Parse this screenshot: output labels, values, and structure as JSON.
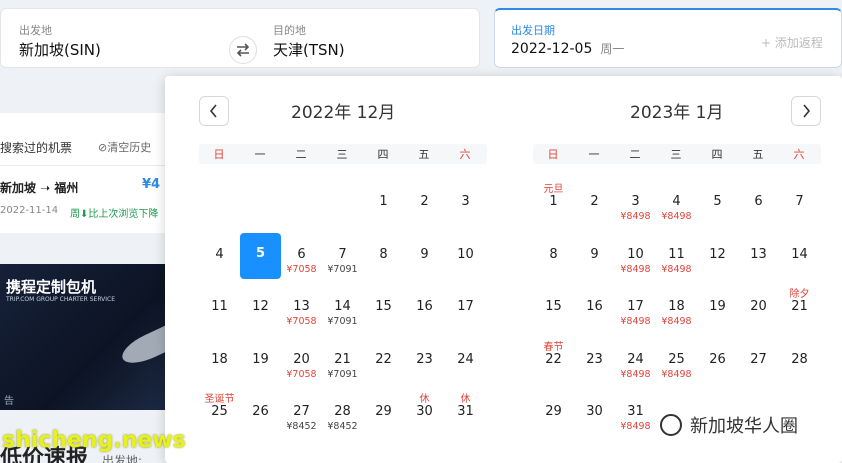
{
  "search": {
    "from_label": "出发地",
    "from_value": "新加坡(SIN)",
    "to_label": "目的地",
    "to_value": "天津(TSN)",
    "date_label": "出发日期",
    "date_value": "2022-12-05",
    "date_week": "周一",
    "return_label": "+ 添加返程"
  },
  "history": {
    "title": "搜索过的机票",
    "clear": "⊘清空历史",
    "route": "新加坡 ➝ 福州",
    "price": "¥4",
    "date": "2022-11-14",
    "trend": "周⬇比上次浏览下降"
  },
  "banner": {
    "title": "携程定制包机",
    "subtitle": "TRIP.COM GROUP CHARTER SERVICE",
    "tag": "告"
  },
  "bottom": {
    "text": "低价速报",
    "sub": "出发地:"
  },
  "calendar": {
    "weekdays": [
      "日",
      "一",
      "二",
      "三",
      "四",
      "五",
      "六"
    ],
    "months": [
      {
        "title": "2022年 12月",
        "days": [
          {
            "n": "1",
            "col": 4,
            "row": 0
          },
          {
            "n": "2",
            "col": 5,
            "row": 0
          },
          {
            "n": "3",
            "col": 6,
            "row": 0
          },
          {
            "n": "4",
            "col": 0,
            "row": 1
          },
          {
            "n": "5",
            "col": 1,
            "row": 1,
            "selected": true
          },
          {
            "n": "6",
            "col": 2,
            "row": 1,
            "price": "¥7058",
            "red": true
          },
          {
            "n": "7",
            "col": 3,
            "row": 1,
            "price": "¥7091"
          },
          {
            "n": "8",
            "col": 4,
            "row": 1
          },
          {
            "n": "9",
            "col": 5,
            "row": 1
          },
          {
            "n": "10",
            "col": 6,
            "row": 1
          },
          {
            "n": "11",
            "col": 0,
            "row": 2
          },
          {
            "n": "12",
            "col": 1,
            "row": 2
          },
          {
            "n": "13",
            "col": 2,
            "row": 2,
            "price": "¥7058",
            "red": true
          },
          {
            "n": "14",
            "col": 3,
            "row": 2,
            "price": "¥7091"
          },
          {
            "n": "15",
            "col": 4,
            "row": 2
          },
          {
            "n": "16",
            "col": 5,
            "row": 2
          },
          {
            "n": "17",
            "col": 6,
            "row": 2
          },
          {
            "n": "18",
            "col": 0,
            "row": 3
          },
          {
            "n": "19",
            "col": 1,
            "row": 3
          },
          {
            "n": "20",
            "col": 2,
            "row": 3,
            "price": "¥7058",
            "red": true
          },
          {
            "n": "21",
            "col": 3,
            "row": 3,
            "price": "¥7091"
          },
          {
            "n": "22",
            "col": 4,
            "row": 3
          },
          {
            "n": "23",
            "col": 5,
            "row": 3
          },
          {
            "n": "24",
            "col": 6,
            "row": 3
          },
          {
            "n": "25",
            "col": 0,
            "row": 4,
            "fest": "圣诞节"
          },
          {
            "n": "26",
            "col": 1,
            "row": 4
          },
          {
            "n": "27",
            "col": 2,
            "row": 4,
            "price": "¥8452"
          },
          {
            "n": "28",
            "col": 3,
            "row": 4,
            "price": "¥8452"
          },
          {
            "n": "29",
            "col": 4,
            "row": 4
          },
          {
            "n": "30",
            "col": 5,
            "row": 4,
            "fest": "休"
          },
          {
            "n": "31",
            "col": 6,
            "row": 4,
            "fest": "休"
          }
        ]
      },
      {
        "title": "2023年 1月",
        "days": [
          {
            "n": "1",
            "col": 0,
            "row": 0,
            "fest": "元旦"
          },
          {
            "n": "2",
            "col": 1,
            "row": 0
          },
          {
            "n": "3",
            "col": 2,
            "row": 0,
            "price": "¥8498",
            "red": true
          },
          {
            "n": "4",
            "col": 3,
            "row": 0,
            "price": "¥8498",
            "red": true
          },
          {
            "n": "5",
            "col": 4,
            "row": 0
          },
          {
            "n": "6",
            "col": 5,
            "row": 0
          },
          {
            "n": "7",
            "col": 6,
            "row": 0
          },
          {
            "n": "8",
            "col": 0,
            "row": 1
          },
          {
            "n": "9",
            "col": 1,
            "row": 1
          },
          {
            "n": "10",
            "col": 2,
            "row": 1,
            "price": "¥8498",
            "red": true
          },
          {
            "n": "11",
            "col": 3,
            "row": 1,
            "price": "¥8498",
            "red": true
          },
          {
            "n": "12",
            "col": 4,
            "row": 1
          },
          {
            "n": "13",
            "col": 5,
            "row": 1
          },
          {
            "n": "14",
            "col": 6,
            "row": 1
          },
          {
            "n": "15",
            "col": 0,
            "row": 2
          },
          {
            "n": "16",
            "col": 1,
            "row": 2
          },
          {
            "n": "17",
            "col": 2,
            "row": 2,
            "price": "¥8498",
            "red": true
          },
          {
            "n": "18",
            "col": 3,
            "row": 2,
            "price": "¥8498",
            "red": true
          },
          {
            "n": "19",
            "col": 4,
            "row": 2
          },
          {
            "n": "20",
            "col": 5,
            "row": 2
          },
          {
            "n": "21",
            "col": 6,
            "row": 2,
            "fest": "除夕"
          },
          {
            "n": "22",
            "col": 0,
            "row": 3,
            "fest": "春节"
          },
          {
            "n": "23",
            "col": 1,
            "row": 3
          },
          {
            "n": "24",
            "col": 2,
            "row": 3,
            "price": "¥8498",
            "red": true
          },
          {
            "n": "25",
            "col": 3,
            "row": 3,
            "price": "¥8498",
            "red": true
          },
          {
            "n": "26",
            "col": 4,
            "row": 3
          },
          {
            "n": "27",
            "col": 5,
            "row": 3
          },
          {
            "n": "28",
            "col": 6,
            "row": 3
          },
          {
            "n": "29",
            "col": 0,
            "row": 4
          },
          {
            "n": "30",
            "col": 1,
            "row": 4
          },
          {
            "n": "31",
            "col": 2,
            "row": 4,
            "price": "¥8498",
            "red": true
          }
        ]
      }
    ]
  },
  "watermark": {
    "right": "新加坡华人圈",
    "left": "shicheng.news"
  }
}
